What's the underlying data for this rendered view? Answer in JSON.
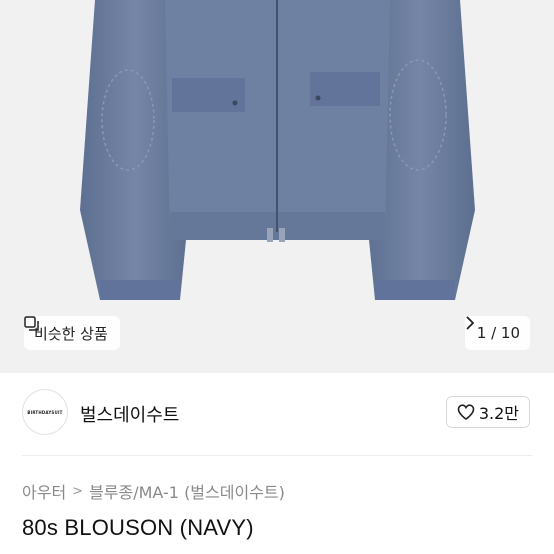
{
  "product_image": {
    "similar_button_label": "비슷한 상품",
    "page_indicator": "1 / 10"
  },
  "shop": {
    "logo_text": "BIRTHDAYSUIT",
    "name": "벌스데이수트",
    "like_count": "3.2만"
  },
  "breadcrumb": {
    "items": [
      "아우터",
      "블루종/MA-1 (벌스데이수트)"
    ]
  },
  "product": {
    "title": "80s BLOUSON (NAVY)"
  },
  "colors": {
    "jacket": "#6b7d9e",
    "background": "#f1f1f1"
  }
}
